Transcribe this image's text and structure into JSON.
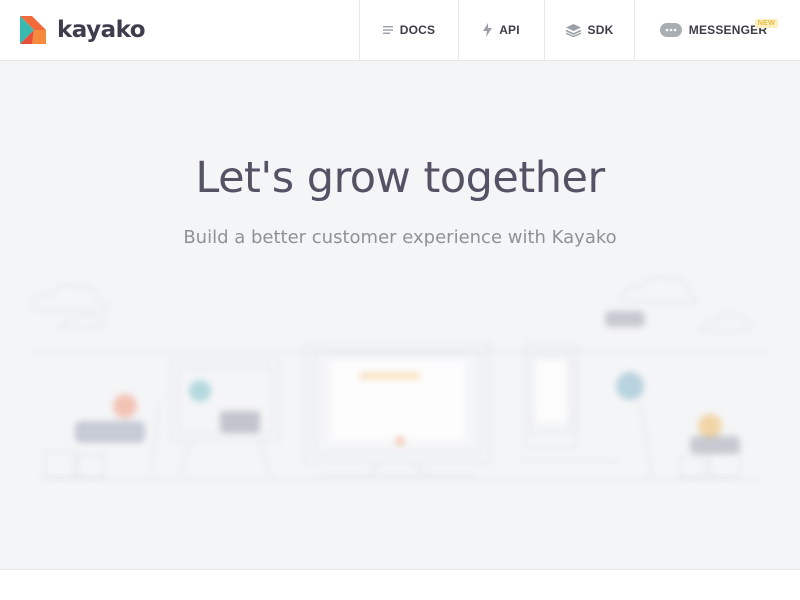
{
  "brand": {
    "name": "kayako",
    "logo_icon": "kayako-logo-icon"
  },
  "nav": {
    "items": [
      {
        "label": "DOCS",
        "icon": "docs-lines-icon"
      },
      {
        "label": "API",
        "icon": "lightning-bolt-icon"
      },
      {
        "label": "SDK",
        "icon": "layers-stack-icon"
      },
      {
        "label": "MESSENGER",
        "icon": "chat-bubble-icon",
        "badge": "NEW"
      }
    ]
  },
  "hero": {
    "title": "Let's grow together",
    "subtitle": "Build a better customer experience with Kayako"
  },
  "colors": {
    "accent_orange": "#f26a39",
    "accent_teal": "#3ab9b0",
    "hero_background": "#f4f5f7",
    "title_text": "#565265",
    "badge_background": "#fdf0bf",
    "badge_text": "#e0a21a"
  }
}
